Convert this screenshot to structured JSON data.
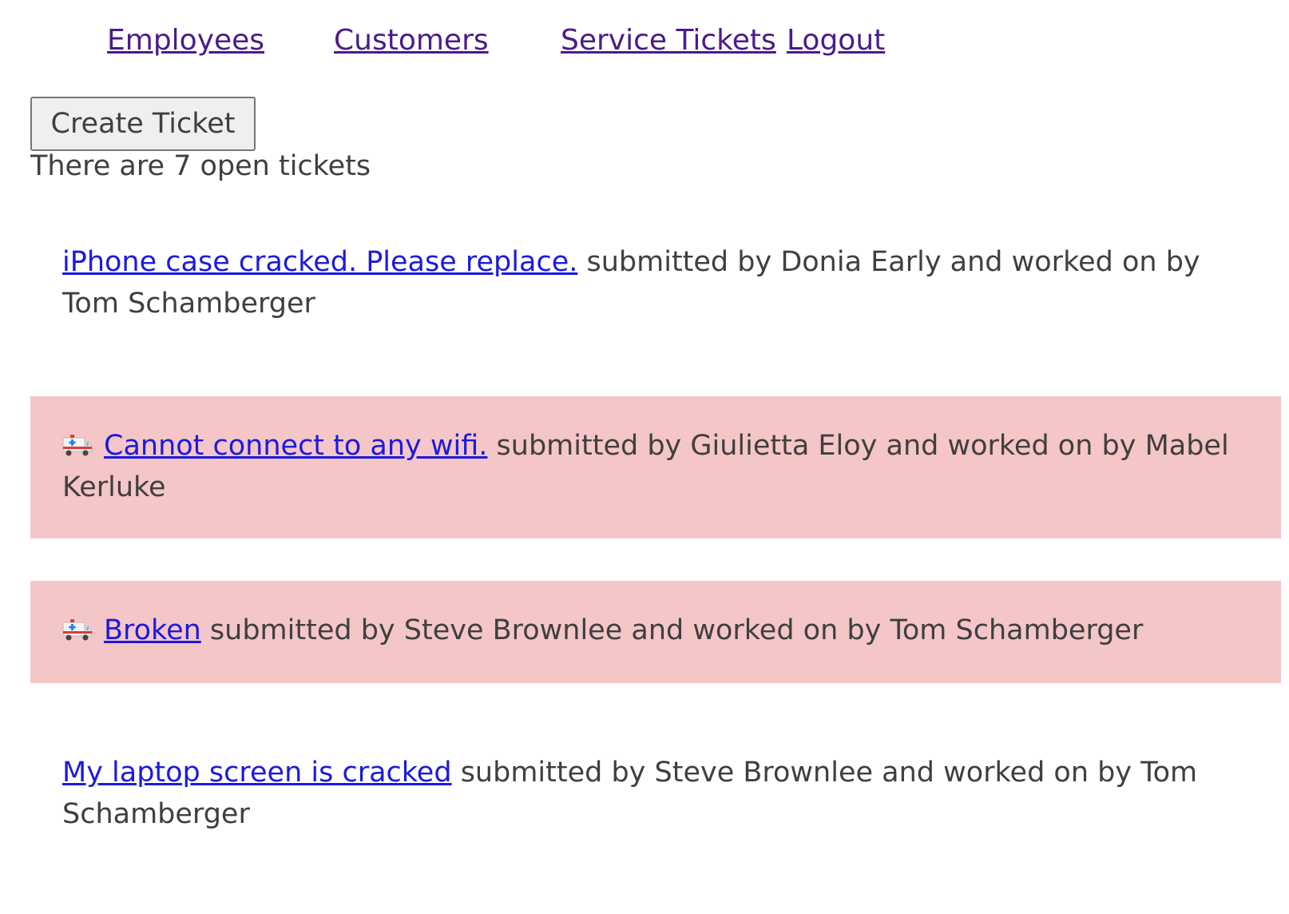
{
  "nav": {
    "employees": "Employees",
    "customers": "Customers",
    "service_tickets": "Service Tickets",
    "logout": "Logout"
  },
  "create_button": "Create Ticket",
  "open_count_text": "There are 7 open tickets",
  "tickets": [
    {
      "title": "iPhone case cracked. Please replace.",
      "details": " submitted by Donia Early and worked on by Tom Schamberger",
      "emergency": false
    },
    {
      "title": "Cannot connect to any wifi.",
      "details": " submitted by Giulietta Eloy and worked on by Mabel Kerluke",
      "emergency": true,
      "icon": "ambulance-icon"
    },
    {
      "title": "Broken",
      "details": " submitted by Steve Brownlee and worked on by Tom Schamberger",
      "emergency": true,
      "icon": "ambulance-icon"
    },
    {
      "title": "My laptop screen is cracked",
      "details": " submitted by Steve Brownlee and worked on by Tom Schamberger",
      "emergency": false
    }
  ],
  "colors": {
    "emergency_bg": "#f5c6c7",
    "nav_link": "#4b1b8a",
    "ticket_link": "#1a1ae0",
    "text": "#3f3f3f"
  }
}
